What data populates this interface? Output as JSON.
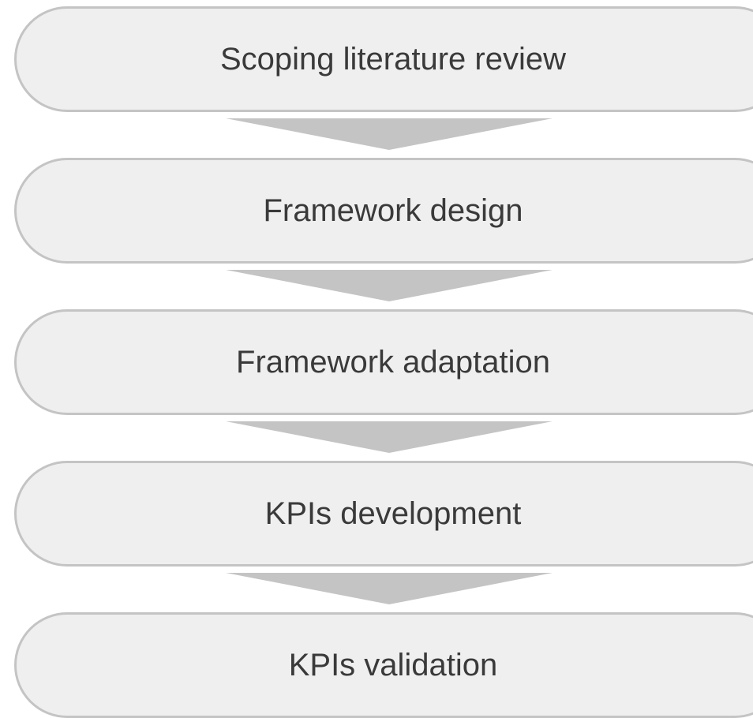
{
  "diagram": {
    "steps": [
      {
        "label": "Scoping literature review"
      },
      {
        "label": "Framework design"
      },
      {
        "label": "Framework adaptation"
      },
      {
        "label": "KPIs development"
      },
      {
        "label": "KPIs validation"
      }
    ],
    "colors": {
      "box_fill": "#efefef",
      "box_border": "#c4c4c4",
      "text": "#3a3a3a",
      "arrow_fill": "#c4c4c4"
    }
  }
}
